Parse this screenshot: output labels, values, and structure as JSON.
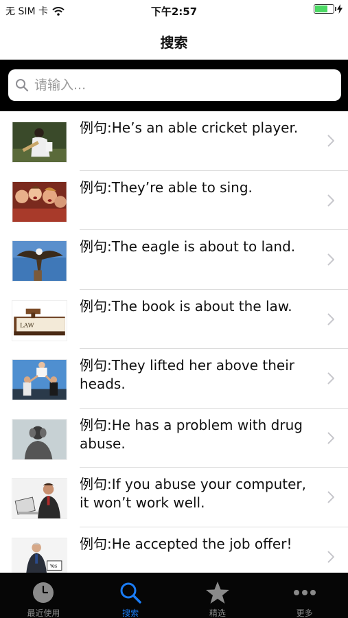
{
  "status_bar": {
    "carrier": "无 SIM 卡",
    "time": "下午2:57",
    "battery_level": 0.7
  },
  "nav": {
    "title": "搜索"
  },
  "search": {
    "placeholder": "请输入..."
  },
  "list": {
    "items": [
      {
        "label": "例句:He’s an able cricket player."
      },
      {
        "label": "例句:They’re able to sing."
      },
      {
        "label": "例句:The eagle is about to land."
      },
      {
        "label": "例句:The book is about the law."
      },
      {
        "label": "例句:They lifted her above their heads."
      },
      {
        "label": "例句:He has a problem with drug abuse."
      },
      {
        "label": "例句:If you abuse your computer, it won’t work well."
      },
      {
        "label": "例句:He accepted the job offer!"
      }
    ]
  },
  "thumb_text": {
    "law_book": "LAW",
    "sign": "Yes"
  },
  "tabs": [
    {
      "label": "最近使用",
      "icon": "clock-icon"
    },
    {
      "label": "搜索",
      "icon": "search-icon"
    },
    {
      "label": "精选",
      "icon": "star-icon"
    },
    {
      "label": "更多",
      "icon": "more-icon"
    }
  ],
  "colors": {
    "accent": "#1a7cf5",
    "tab_inactive": "#8a8a8a",
    "battery": "#4cd964"
  }
}
